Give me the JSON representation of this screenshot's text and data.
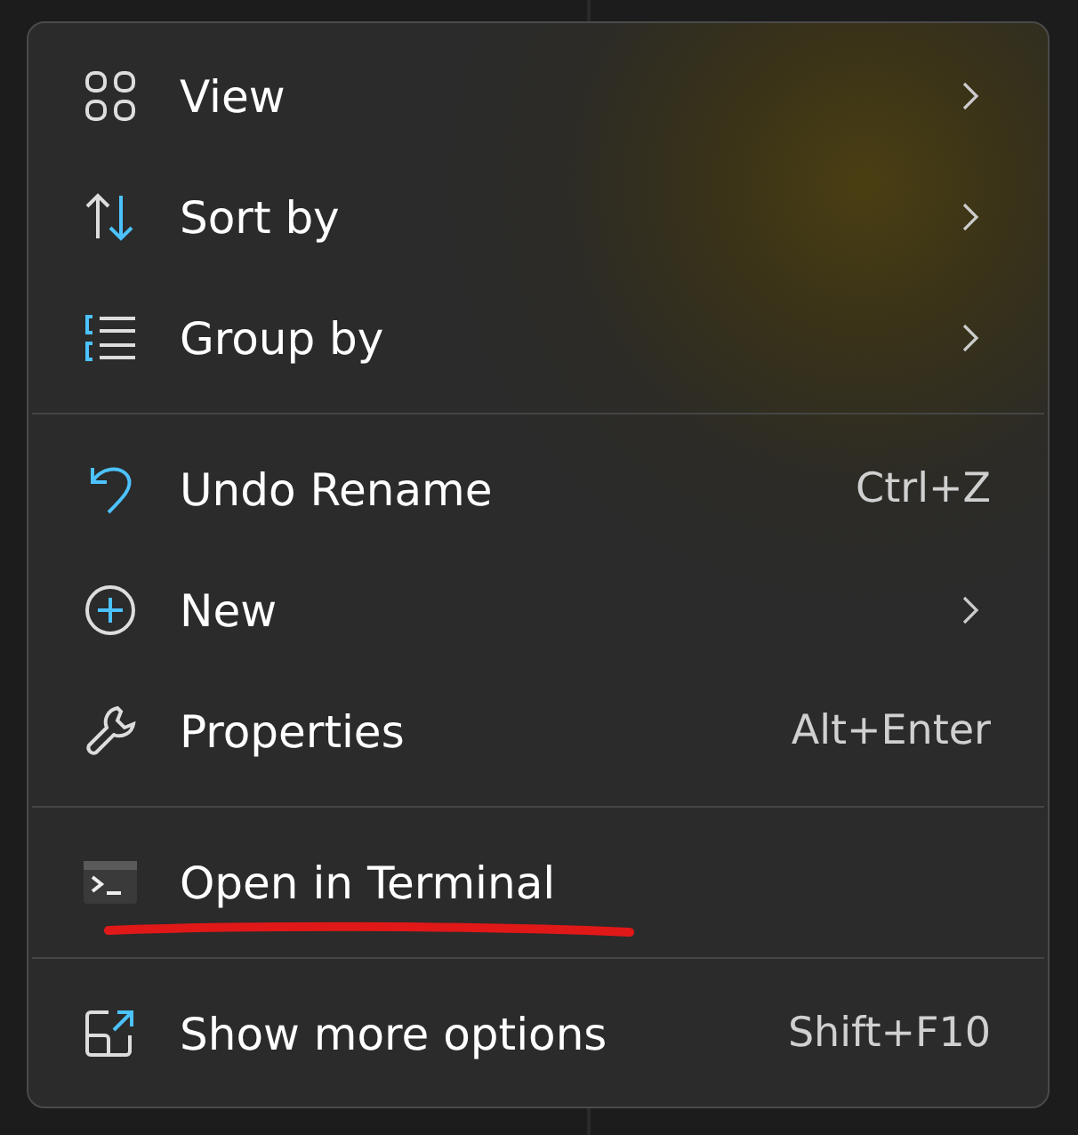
{
  "menu": {
    "groups": [
      [
        {
          "label": "View",
          "submenu": true,
          "annotated": false
        },
        {
          "label": "Sort by",
          "submenu": true,
          "annotated": false
        },
        {
          "label": "Group by",
          "submenu": true,
          "annotated": false
        }
      ],
      [
        {
          "label": "Undo Rename",
          "shortcut": "Ctrl+Z",
          "submenu": false,
          "annotated": false
        },
        {
          "label": "New",
          "submenu": true,
          "annotated": false
        },
        {
          "label": "Properties",
          "shortcut": "Alt+Enter",
          "submenu": false,
          "annotated": false
        }
      ],
      [
        {
          "label": "Open in Terminal",
          "submenu": false,
          "annotated": true
        }
      ],
      [
        {
          "label": "Show more options",
          "shortcut": "Shift+F10",
          "submenu": false,
          "annotated": false
        }
      ]
    ]
  }
}
